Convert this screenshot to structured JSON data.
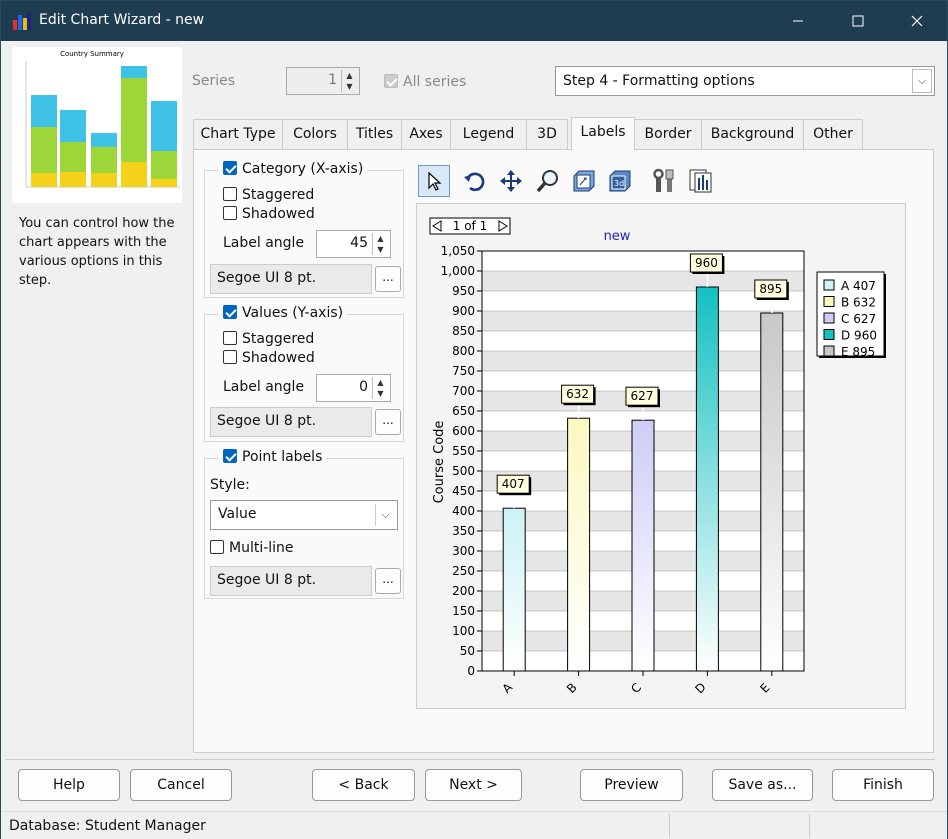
{
  "window": {
    "title": "Edit Chart Wizard - new",
    "minimize_icon": "minimize-icon",
    "maximize_icon": "maximize-icon",
    "close_icon": "close-icon"
  },
  "thumbnail": {
    "title": "Country Summary"
  },
  "help_text": "You can control how the chart appears with the various options in this step.",
  "series": {
    "label": "Series",
    "value": "1",
    "all_series_label": "All series",
    "all_series_checked": true
  },
  "step_select": {
    "value": "Step 4 - Formatting options"
  },
  "tabs": [
    {
      "label": "Chart Type"
    },
    {
      "label": "Colors"
    },
    {
      "label": "Titles"
    },
    {
      "label": "Axes"
    },
    {
      "label": "Legend"
    },
    {
      "label": "3D"
    },
    {
      "label": "Labels"
    },
    {
      "label": "Border"
    },
    {
      "label": "Background"
    },
    {
      "label": "Other"
    }
  ],
  "active_tab": "Labels",
  "category": {
    "title": "Category (X-axis)",
    "checked": true,
    "staggered": "Staggered",
    "shadowed": "Shadowed",
    "angle_label": "Label angle",
    "angle_value": "45",
    "font": "Segoe UI 8 pt.",
    "font_button": "..."
  },
  "values_axis": {
    "title": "Values (Y-axis)",
    "checked": true,
    "staggered": "Staggered",
    "shadowed": "Shadowed",
    "angle_label": "Label angle",
    "angle_value": "0",
    "font": "Segoe UI 8 pt.",
    "font_button": "..."
  },
  "point_labels": {
    "title": "Point labels",
    "checked": true,
    "style_label": "Style:",
    "style_value": "Value",
    "multiline": "Multi-line",
    "font": "Segoe UI 8 pt.",
    "font_button": "..."
  },
  "toolbar": [
    "pointer-icon",
    "rotate-icon",
    "move-icon",
    "zoom-icon",
    "view-2d-icon",
    "view-3d-icon",
    "tools-icon",
    "data-grid-icon"
  ],
  "chart_nav": {
    "label": "1 of 1"
  },
  "chart_data": {
    "type": "bar",
    "title": "new",
    "ylabel": "Course Code",
    "xlabel": "",
    "categories": [
      "A",
      "B",
      "C",
      "D",
      "E"
    ],
    "values": [
      407,
      632,
      627,
      960,
      895
    ],
    "ylim": [
      0,
      1050
    ],
    "yticks": [
      0,
      50,
      100,
      150,
      200,
      250,
      300,
      350,
      400,
      450,
      500,
      550,
      600,
      650,
      700,
      750,
      800,
      850,
      900,
      950,
      1000,
      1050
    ],
    "ytick_labels": [
      "0",
      "50",
      "100",
      "150",
      "200",
      "250",
      "300",
      "350",
      "400",
      "450",
      "500",
      "550",
      "600",
      "650",
      "700",
      "750",
      "800",
      "850",
      "900",
      "950",
      "1,000",
      "1,050"
    ],
    "colors": [
      "#ccf2f4",
      "#fbf8c0",
      "#cdcdf6",
      "#14c0c0",
      "#c8c8c8"
    ],
    "legend": [
      "A 407",
      "B 632",
      "C 627",
      "D 960",
      "E 895"
    ],
    "legend_position": "right",
    "x_label_angle": 45,
    "grid": true
  },
  "buttons": {
    "help": "Help",
    "cancel": "Cancel",
    "back": "< Back",
    "next": "Next >",
    "preview": "Preview",
    "save_as": "Save as...",
    "finish": "Finish"
  },
  "status": {
    "database": "Database: Student Manager"
  }
}
